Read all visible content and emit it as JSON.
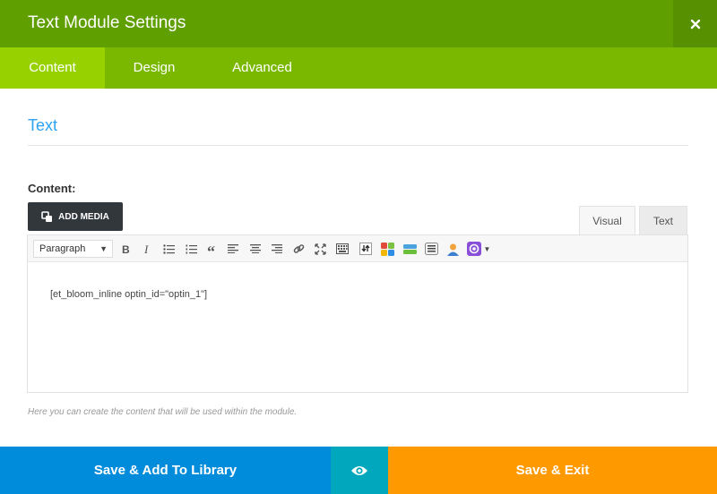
{
  "modal": {
    "title": "Text Module Settings",
    "close_icon": "close-icon"
  },
  "tabs": [
    {
      "label": "Content",
      "active": true
    },
    {
      "label": "Design",
      "active": false
    },
    {
      "label": "Advanced",
      "active": false
    }
  ],
  "section": {
    "title": "Text"
  },
  "content_field": {
    "label": "Content:",
    "add_media_label": "ADD MEDIA",
    "editor_tabs": {
      "visual": "Visual",
      "text": "Text"
    },
    "format_select": "Paragraph",
    "toolbar_icons": [
      "bold-icon",
      "italic-icon",
      "bullet-list-icon",
      "numbered-list-icon",
      "blockquote-icon",
      "align-left-icon",
      "align-center-icon",
      "align-right-icon",
      "link-icon",
      "fullscreen-icon",
      "toolbar-toggle-icon",
      "bloom-import-icon",
      "layout-blocks-icon",
      "divider-shortcode-icon",
      "list-shortcode-icon",
      "user-shortcode-icon",
      "bloom-optin-icon"
    ],
    "value": "[et_bloom_inline optin_id=\"optin_1\"]",
    "help": "Here you can create the content that will be used within the module."
  },
  "footer": {
    "save_library_label": "Save & Add To Library",
    "preview_icon": "eye-icon",
    "save_exit_label": "Save & Exit"
  },
  "colors": {
    "header": "#5f9f00",
    "tabs": "#7ab800",
    "tab_active": "#97d200",
    "accent_blue": "#2ea3f2",
    "btn_library": "#008bdb",
    "btn_preview": "#00a7bd",
    "btn_exit": "#ff9900"
  }
}
